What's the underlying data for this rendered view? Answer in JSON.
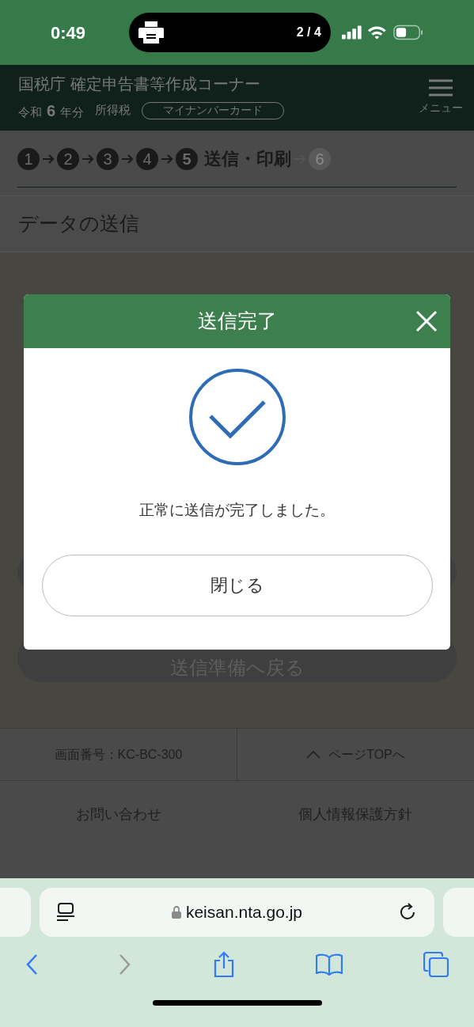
{
  "status_bar": {
    "time": "0:49",
    "activity_counter": "2 / 4"
  },
  "header": {
    "title": "国税庁 確定申告書等作成コーナー",
    "era": "令和",
    "year": "6",
    "year_suffix": "年分",
    "tax": "所得税",
    "badge": "マイナンバーカード",
    "menu_label": "メニュー"
  },
  "steps": [
    {
      "number": "1",
      "selected": false,
      "disabled": false
    },
    {
      "number": "2",
      "selected": false,
      "disabled": false
    },
    {
      "number": "3",
      "selected": false,
      "disabled": false
    },
    {
      "number": "4",
      "selected": false,
      "disabled": false
    },
    {
      "number": "5",
      "selected": true,
      "disabled": false,
      "label": "送信・印刷"
    },
    {
      "number": "6",
      "selected": false,
      "disabled": true
    }
  ],
  "section_title": "データの送信",
  "back_button": "送信準備へ戻る",
  "footer": {
    "screen_id": "画面番号：KC-BC-300",
    "page_top": "ページTOPへ",
    "links": [
      "お問い合わせ",
      "個人情報保護方針"
    ]
  },
  "browser": {
    "url": "keisan.nta.go.jp",
    "back_enabled": true,
    "forward_enabled": false
  },
  "dialog": {
    "title": "送信完了",
    "message": "正常に送信が完了しました。",
    "close_button": "閉じる"
  }
}
